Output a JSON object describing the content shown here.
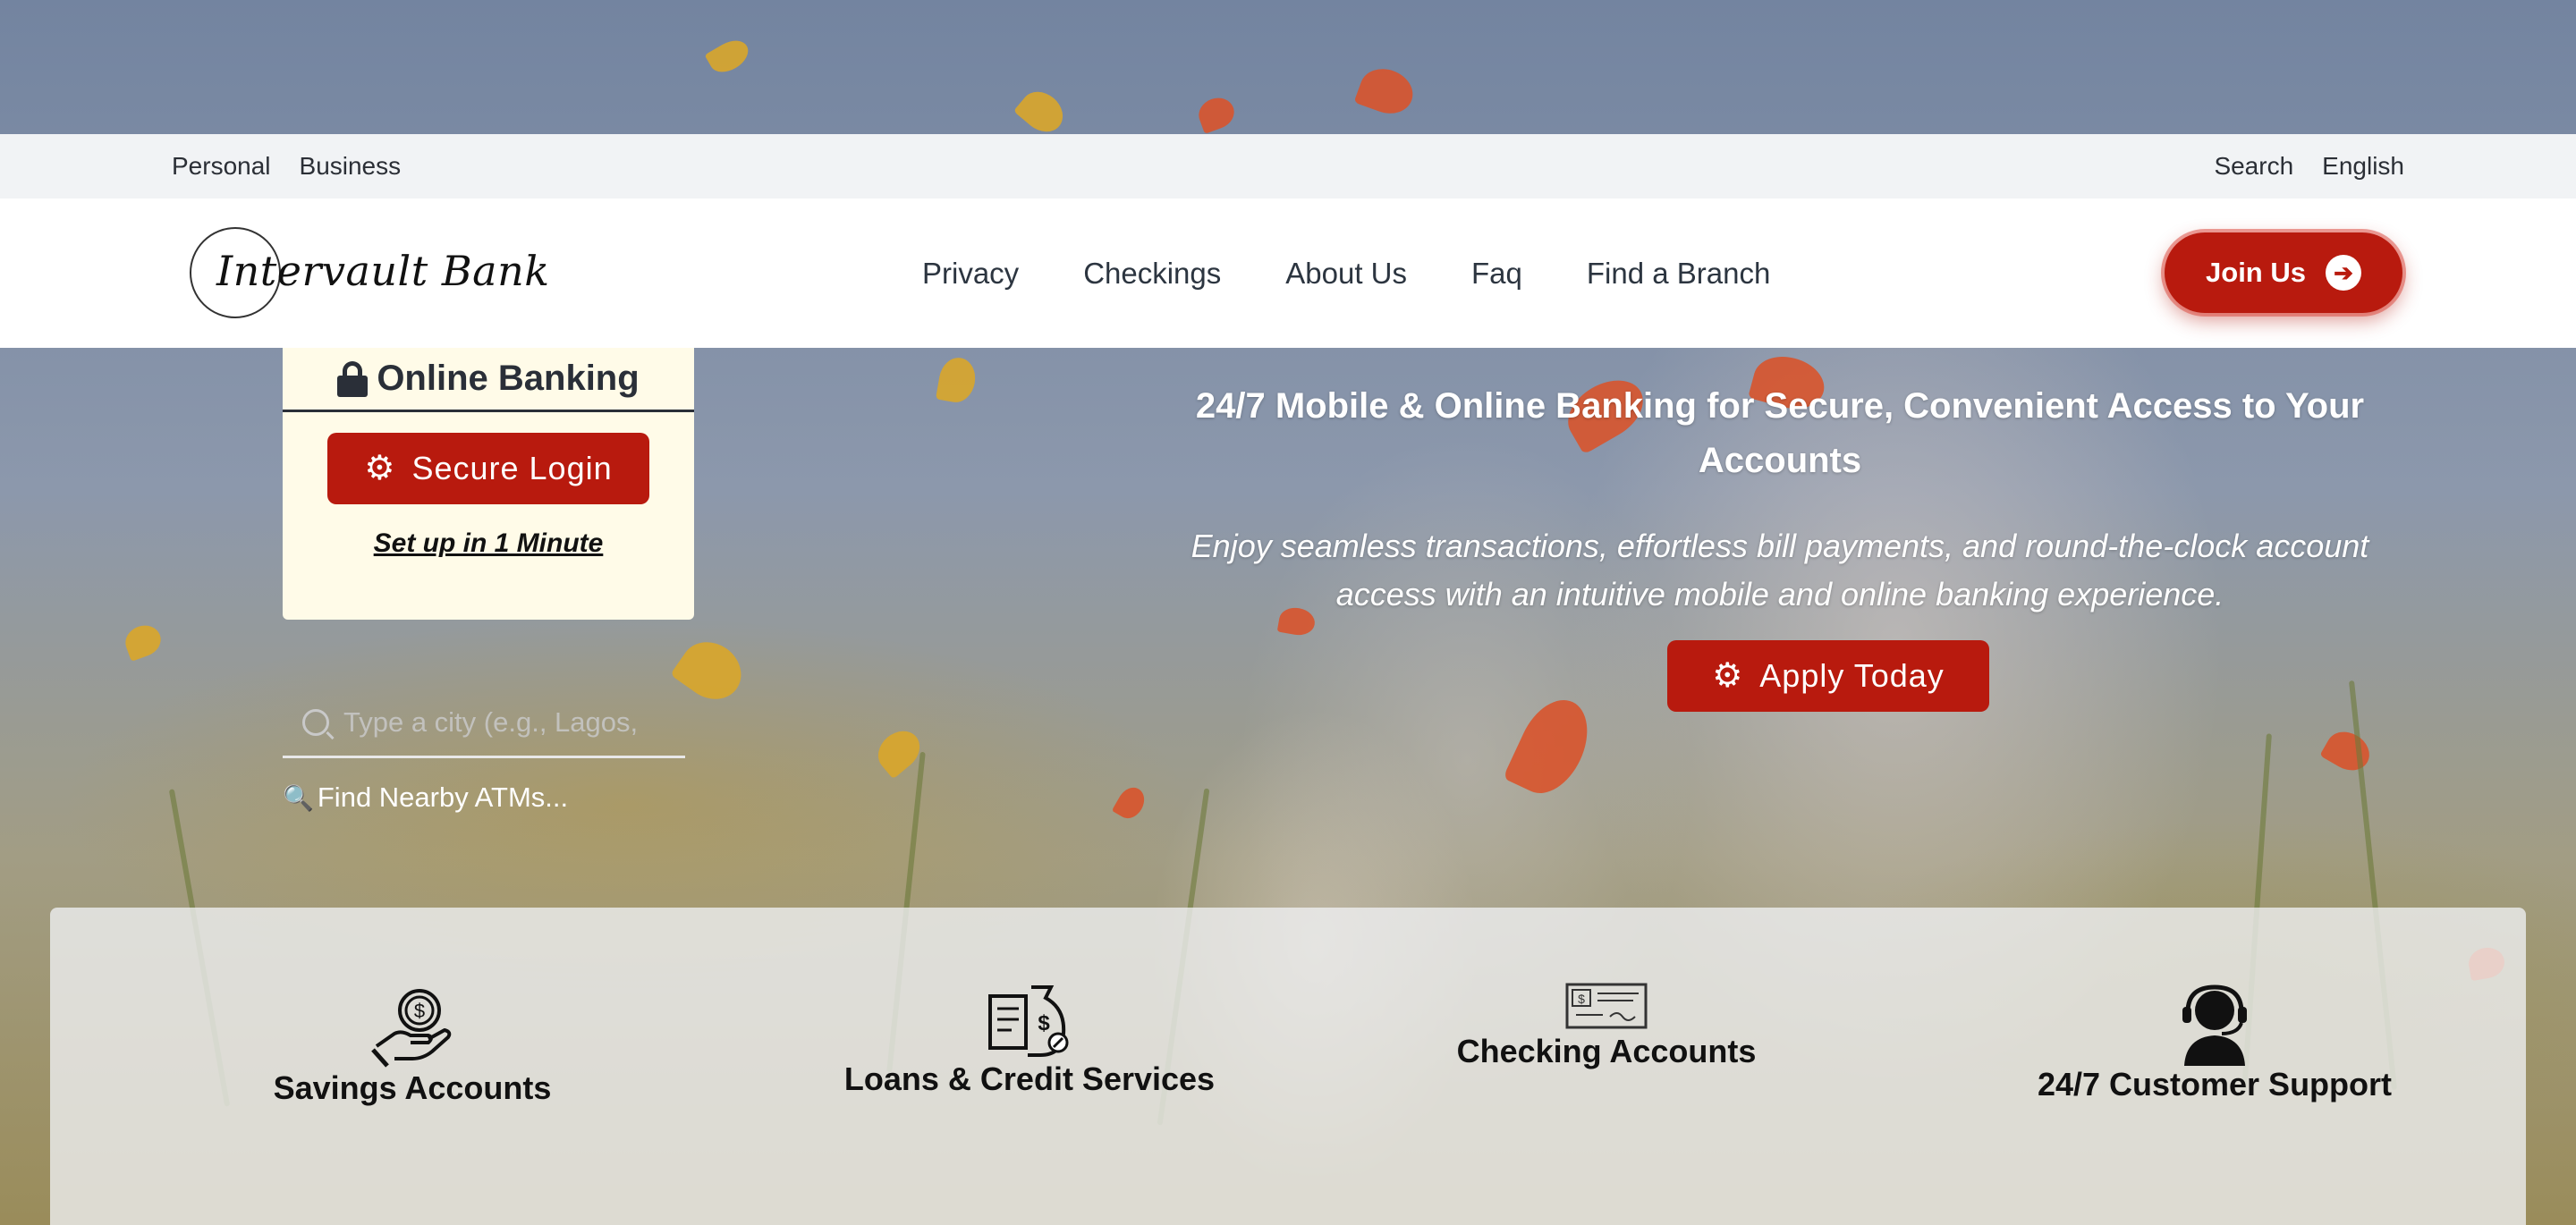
{
  "topbar": {
    "left_links": [
      "Personal",
      "Business"
    ],
    "search_label": "Search",
    "language_label": "English"
  },
  "header": {
    "logo_text": "Intervault Bank",
    "nav": [
      "Privacy",
      "Checkings",
      "About Us",
      "Faq",
      "Find a Branch"
    ],
    "join_label": "Join Us",
    "join_icon": "arrow-right-circle-icon"
  },
  "online_banking": {
    "title": "Online Banking",
    "title_icon": "lock-icon",
    "login_label": "Secure Login",
    "login_icon": "gear-icon",
    "setup_link": "Set up in 1 Minute"
  },
  "atm": {
    "placeholder": "Type a city (e.g., Lagos,",
    "link_text": "Find Nearby ATMs...",
    "link_icon": "magnifier-icon"
  },
  "hero": {
    "title": "24/7 Mobile & Online Banking for Secure, Convenient Access to Your Accounts",
    "subtitle": "Enjoy seamless transactions, effortless bill payments, and round-the-clock account access with an intuitive mobile and online banking experience.",
    "apply_label": "Apply Today",
    "apply_icon": "gear-icon"
  },
  "services": [
    {
      "label": "Savings Accounts",
      "icon": "hand-coin-icon"
    },
    {
      "label": "Loans & Credit Services",
      "icon": "money-bag-document-icon"
    },
    {
      "label": "Checking Accounts",
      "icon": "check-document-icon"
    },
    {
      "label": "24/7 Customer Support",
      "icon": "headset-agent-icon"
    }
  ],
  "colors": {
    "accent": "#b81a0e",
    "card_bg": "#fffbe8",
    "topbar_bg": "#f1f3f5"
  }
}
